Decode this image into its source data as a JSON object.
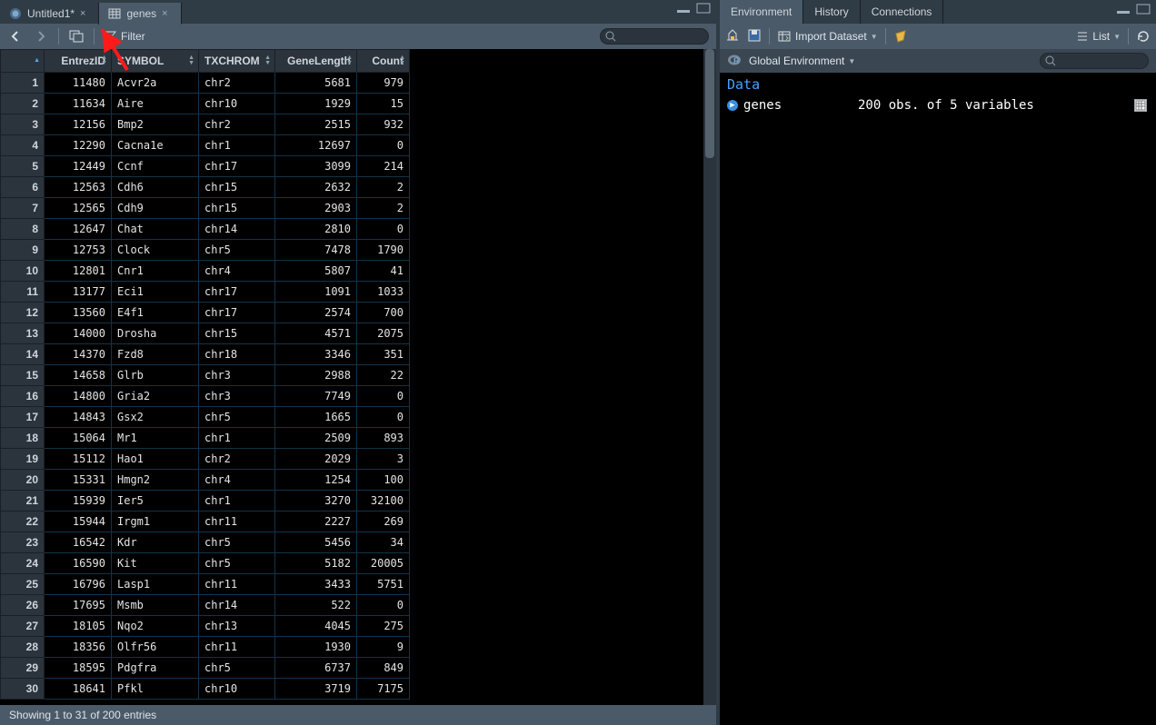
{
  "source_tabs": {
    "tab0": {
      "label": "Untitled1*"
    },
    "tab1": {
      "label": "genes"
    }
  },
  "toolbar": {
    "filter_label": "Filter",
    "search_placeholder": ""
  },
  "columns": {
    "entrez": "EntrezID",
    "symbol": "SYMBOL",
    "chrom": "TXCHROM",
    "len": "GeneLength",
    "count": "Count"
  },
  "rows": [
    {
      "n": 1,
      "entrez": 11480,
      "symbol": "Acvr2a",
      "chrom": "chr2",
      "len": 5681,
      "count": 979
    },
    {
      "n": 2,
      "entrez": 11634,
      "symbol": "Aire",
      "chrom": "chr10",
      "len": 1929,
      "count": 15
    },
    {
      "n": 3,
      "entrez": 12156,
      "symbol": "Bmp2",
      "chrom": "chr2",
      "len": 2515,
      "count": 932
    },
    {
      "n": 4,
      "entrez": 12290,
      "symbol": "Cacna1e",
      "chrom": "chr1",
      "len": 12697,
      "count": 0
    },
    {
      "n": 5,
      "entrez": 12449,
      "symbol": "Ccnf",
      "chrom": "chr17",
      "len": 3099,
      "count": 214
    },
    {
      "n": 6,
      "entrez": 12563,
      "symbol": "Cdh6",
      "chrom": "chr15",
      "len": 2632,
      "count": 2
    },
    {
      "n": 7,
      "entrez": 12565,
      "symbol": "Cdh9",
      "chrom": "chr15",
      "len": 2903,
      "count": 2
    },
    {
      "n": 8,
      "entrez": 12647,
      "symbol": "Chat",
      "chrom": "chr14",
      "len": 2810,
      "count": 0
    },
    {
      "n": 9,
      "entrez": 12753,
      "symbol": "Clock",
      "chrom": "chr5",
      "len": 7478,
      "count": 1790
    },
    {
      "n": 10,
      "entrez": 12801,
      "symbol": "Cnr1",
      "chrom": "chr4",
      "len": 5807,
      "count": 41
    },
    {
      "n": 11,
      "entrez": 13177,
      "symbol": "Eci1",
      "chrom": "chr17",
      "len": 1091,
      "count": 1033
    },
    {
      "n": 12,
      "entrez": 13560,
      "symbol": "E4f1",
      "chrom": "chr17",
      "len": 2574,
      "count": 700
    },
    {
      "n": 13,
      "entrez": 14000,
      "symbol": "Drosha",
      "chrom": "chr15",
      "len": 4571,
      "count": 2075
    },
    {
      "n": 14,
      "entrez": 14370,
      "symbol": "Fzd8",
      "chrom": "chr18",
      "len": 3346,
      "count": 351
    },
    {
      "n": 15,
      "entrez": 14658,
      "symbol": "Glrb",
      "chrom": "chr3",
      "len": 2988,
      "count": 22
    },
    {
      "n": 16,
      "entrez": 14800,
      "symbol": "Gria2",
      "chrom": "chr3",
      "len": 7749,
      "count": 0
    },
    {
      "n": 17,
      "entrez": 14843,
      "symbol": "Gsx2",
      "chrom": "chr5",
      "len": 1665,
      "count": 0
    },
    {
      "n": 18,
      "entrez": 15064,
      "symbol": "Mr1",
      "chrom": "chr1",
      "len": 2509,
      "count": 893
    },
    {
      "n": 19,
      "entrez": 15112,
      "symbol": "Hao1",
      "chrom": "chr2",
      "len": 2029,
      "count": 3
    },
    {
      "n": 20,
      "entrez": 15331,
      "symbol": "Hmgn2",
      "chrom": "chr4",
      "len": 1254,
      "count": 100
    },
    {
      "n": 21,
      "entrez": 15939,
      "symbol": "Ier5",
      "chrom": "chr1",
      "len": 3270,
      "count": 32100
    },
    {
      "n": 22,
      "entrez": 15944,
      "symbol": "Irgm1",
      "chrom": "chr11",
      "len": 2227,
      "count": 269
    },
    {
      "n": 23,
      "entrez": 16542,
      "symbol": "Kdr",
      "chrom": "chr5",
      "len": 5456,
      "count": 34
    },
    {
      "n": 24,
      "entrez": 16590,
      "symbol": "Kit",
      "chrom": "chr5",
      "len": 5182,
      "count": 20005
    },
    {
      "n": 25,
      "entrez": 16796,
      "symbol": "Lasp1",
      "chrom": "chr11",
      "len": 3433,
      "count": 5751
    },
    {
      "n": 26,
      "entrez": 17695,
      "symbol": "Msmb",
      "chrom": "chr14",
      "len": 522,
      "count": 0
    },
    {
      "n": 27,
      "entrez": 18105,
      "symbol": "Nqo2",
      "chrom": "chr13",
      "len": 4045,
      "count": 275
    },
    {
      "n": 28,
      "entrez": 18356,
      "symbol": "Olfr56",
      "chrom": "chr11",
      "len": 1930,
      "count": 9
    },
    {
      "n": 29,
      "entrez": 18595,
      "symbol": "Pdgfra",
      "chrom": "chr5",
      "len": 6737,
      "count": 849
    },
    {
      "n": 30,
      "entrez": 18641,
      "symbol": "Pfkl",
      "chrom": "chr10",
      "len": 3719,
      "count": 7175
    }
  ],
  "status": "Showing 1 to 31 of 200 entries",
  "env": {
    "tab_env": "Environment",
    "tab_hist": "History",
    "tab_conn": "Connections",
    "import_label": "Import Dataset",
    "scope_label": "Global Environment",
    "list_label": "List",
    "heading": "Data",
    "row": {
      "name": "genes",
      "desc": "200 obs. of 5 variables"
    }
  }
}
